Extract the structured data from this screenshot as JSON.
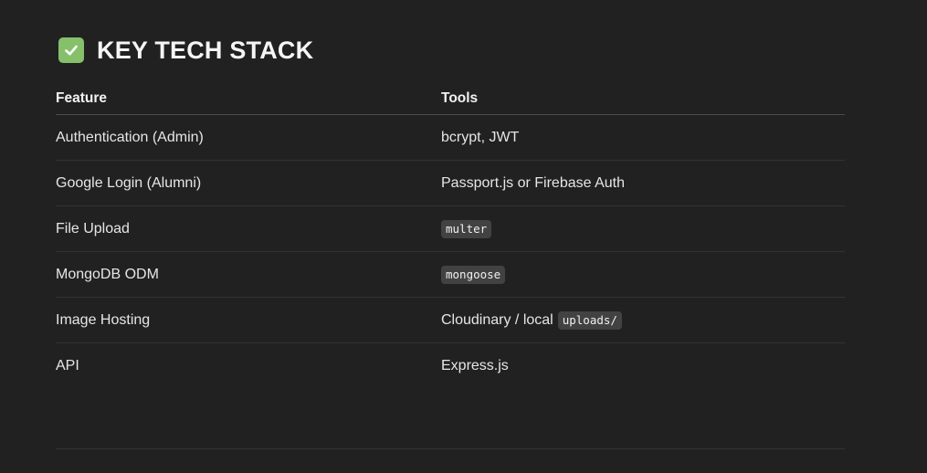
{
  "heading": {
    "icon": "check-mark-icon",
    "text": "KEY TECH STACK",
    "icon_color": "#86c06a"
  },
  "table": {
    "headers": {
      "feature": "Feature",
      "tools": "Tools"
    },
    "rows": [
      {
        "feature": "Authentication (Admin)",
        "tools_text": "bcrypt, JWT",
        "tools_code": ""
      },
      {
        "feature": "Google Login (Alumni)",
        "tools_text": "Passport.js or Firebase Auth",
        "tools_code": ""
      },
      {
        "feature": "File Upload",
        "tools_text": "",
        "tools_code": "multer"
      },
      {
        "feature": "MongoDB ODM",
        "tools_text": "",
        "tools_code": "mongoose"
      },
      {
        "feature": "Image Hosting",
        "tools_text": "Cloudinary / local",
        "tools_code": "uploads/"
      },
      {
        "feature": "API",
        "tools_text": "Express.js",
        "tools_code": ""
      }
    ]
  },
  "colors": {
    "background": "#212121",
    "code_background": "#424242"
  }
}
